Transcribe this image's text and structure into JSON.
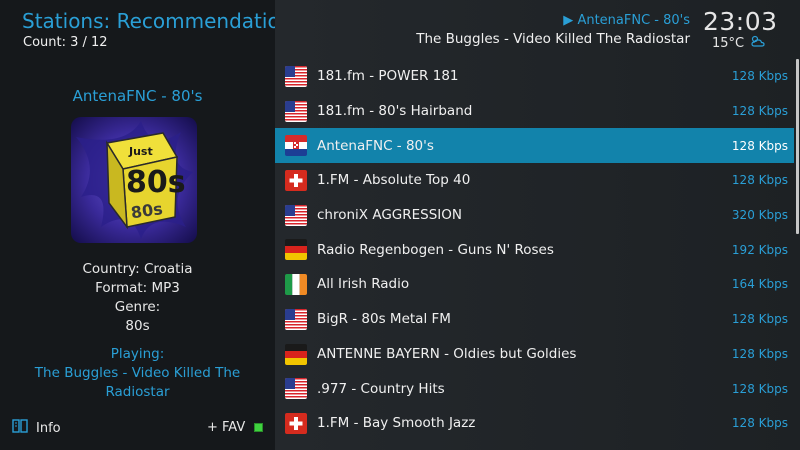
{
  "header": {
    "title": "Stations: Recommendations",
    "count": "Count: 3 / 12"
  },
  "now_playing": {
    "station": "AntenaFNC - 80's",
    "track": "The Buggles - Video Killed The Radiostar"
  },
  "clock": {
    "time": "23:03",
    "temperature": "15°C",
    "weather_icon": "partly-cloudy-icon"
  },
  "details": {
    "station_title": "AntenaFNC - 80's",
    "country": "Country: Croatia",
    "format": "Format: MP3",
    "genre_label": "Genre:",
    "genre_value": "80s",
    "playing_label": "Playing:",
    "playing_track": "The Buggles - Video Killed The Radiostar",
    "art_text_top": "Just",
    "art_text_main": "80s"
  },
  "footer": {
    "info_label": "Info",
    "fav_label": "+ FAV"
  },
  "stations": [
    {
      "name": "181.fm - POWER 181",
      "kbps": "128 Kbps",
      "flag": "us"
    },
    {
      "name": "181.fm - 80's Hairband",
      "kbps": "128 Kbps",
      "flag": "us"
    },
    {
      "name": "AntenaFNC - 80's",
      "kbps": "128 Kbps",
      "flag": "hr",
      "selected": true
    },
    {
      "name": "1.FM - Absolute Top 40",
      "kbps": "128 Kbps",
      "flag": "ch"
    },
    {
      "name": "chroniX AGGRESSION",
      "kbps": "320 Kbps",
      "flag": "us"
    },
    {
      "name": "Radio Regenbogen - Guns N' Roses",
      "kbps": "192 Kbps",
      "flag": "de"
    },
    {
      "name": "All Irish Radio",
      "kbps": "164 Kbps",
      "flag": "ie"
    },
    {
      "name": "BigR - 80s Metal FM",
      "kbps": "128 Kbps",
      "flag": "us"
    },
    {
      "name": "ANTENNE BAYERN - Oldies but Goldies",
      "kbps": "128 Kbps",
      "flag": "de"
    },
    {
      "name": ".977 - Country Hits",
      "kbps": "128 Kbps",
      "flag": "us"
    },
    {
      "name": "1.FM - Bay Smooth Jazz",
      "kbps": "128 Kbps",
      "flag": "ch"
    }
  ],
  "colors": {
    "accent": "#2a9fd6",
    "selected_row": "#1283ab",
    "fav_indicator": "#3fd23f"
  }
}
